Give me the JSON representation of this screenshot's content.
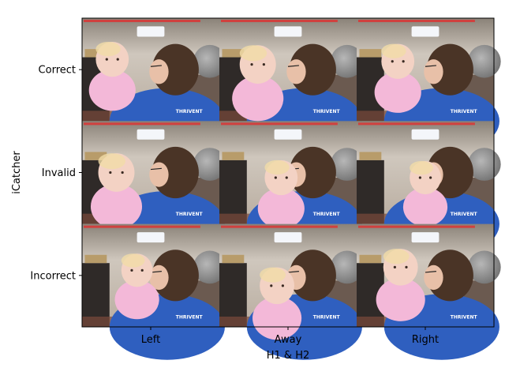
{
  "chart_data": {
    "type": "image_grid",
    "xlabel": "H1 & H2",
    "ylabel": "iCatcher",
    "x_categories": [
      "Left",
      "Away",
      "Right"
    ],
    "y_categories": [
      "Correct",
      "Invalid",
      "Incorrect"
    ],
    "cells": [
      {
        "row": "Correct",
        "col": "Left"
      },
      {
        "row": "Correct",
        "col": "Away"
      },
      {
        "row": "Correct",
        "col": "Right"
      },
      {
        "row": "Invalid",
        "col": "Left"
      },
      {
        "row": "Invalid",
        "col": "Away"
      },
      {
        "row": "Invalid",
        "col": "Right"
      },
      {
        "row": "Incorrect",
        "col": "Left"
      },
      {
        "row": "Incorrect",
        "col": "Away"
      },
      {
        "row": "Incorrect",
        "col": "Right"
      }
    ],
    "grid": false
  },
  "frame": {
    "shirt_text": "THRIVENT"
  },
  "colors": {
    "wall": "#cfc7bd",
    "shirt": "#2f5fbf",
    "hair": "#4a3426",
    "baby_skin": "#f3d2c4",
    "baby_shirt": "#f3b8d8",
    "furniture": "#2f2a28",
    "watermark": "#e03030"
  }
}
